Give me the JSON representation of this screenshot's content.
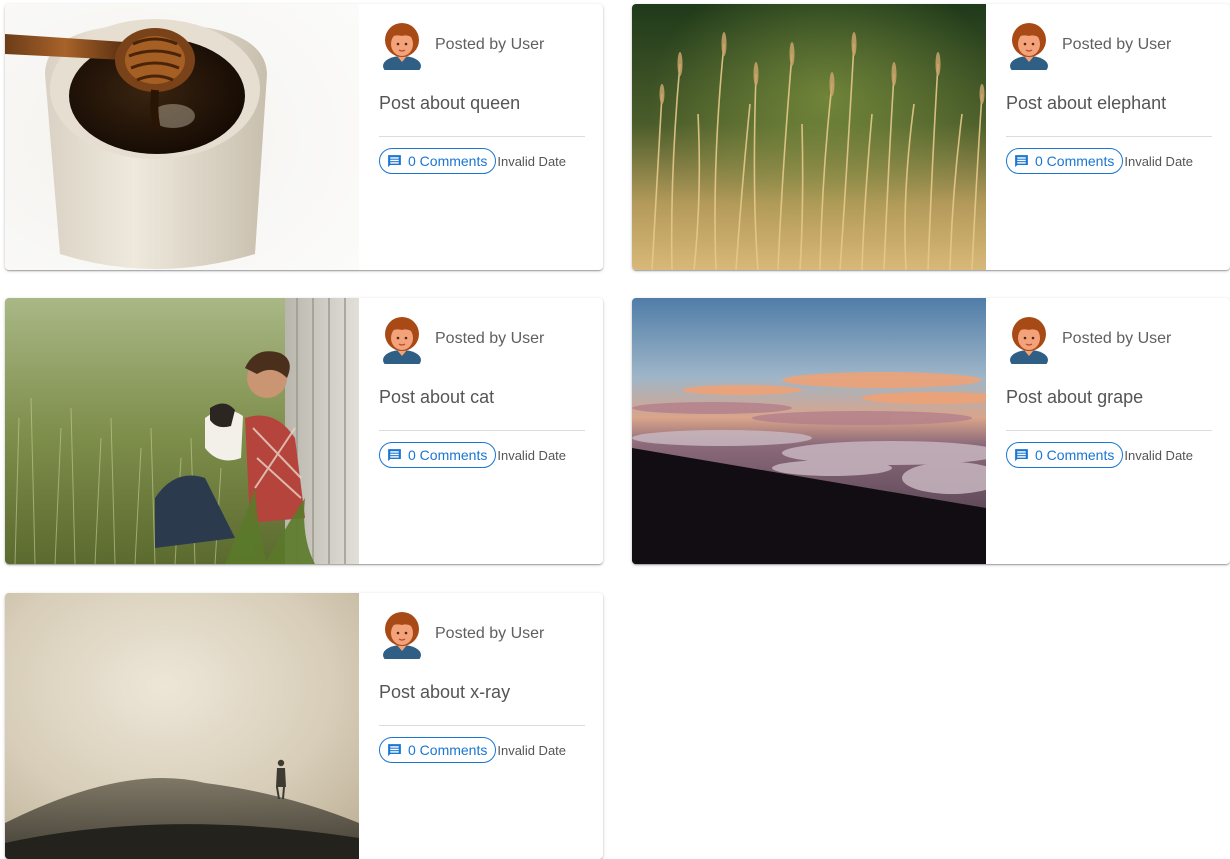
{
  "colors": {
    "accent": "#1976d2",
    "text_secondary": "#5f5f5f",
    "divider": "#dcdcdc"
  },
  "icons": {
    "comment": "comment-icon",
    "avatar": "user-avatar"
  },
  "posts": [
    {
      "author": "Posted by User",
      "title": "Post about queen",
      "comments": "0 Comments",
      "date": "Invalid Date",
      "image": "honey-jar-photo"
    },
    {
      "author": "Posted by User",
      "title": "Post about elephant",
      "comments": "0 Comments",
      "date": "Invalid Date",
      "image": "grass-field-photo"
    },
    {
      "author": "Posted by User",
      "title": "Post about cat",
      "comments": "0 Comments",
      "date": "Invalid Date",
      "image": "man-with-dog-photo"
    },
    {
      "author": "Posted by User",
      "title": "Post about grape",
      "comments": "0 Comments",
      "date": "Invalid Date",
      "image": "sunset-clouds-photo"
    },
    {
      "author": "Posted by User",
      "title": "Post about x-ray",
      "comments": "0 Comments",
      "date": "Invalid Date",
      "image": "foggy-hill-photo"
    }
  ]
}
